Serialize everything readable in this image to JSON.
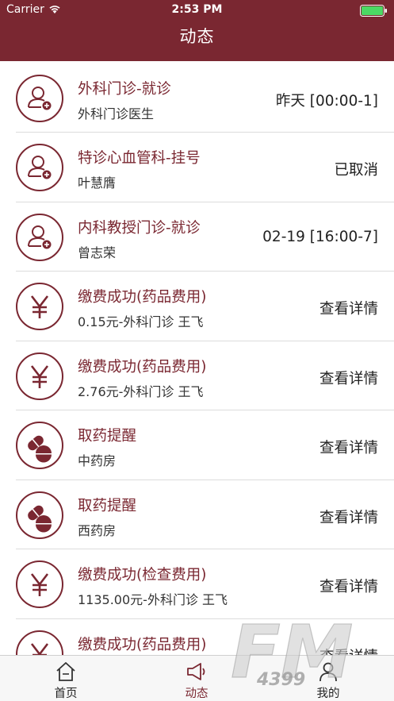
{
  "status_bar": {
    "carrier": "Carrier",
    "time": "2:53 PM"
  },
  "header": {
    "title": "动态"
  },
  "colors": {
    "brand": "#7a2731",
    "battery": "#4cd964",
    "background": "#ffffff"
  },
  "feed": [
    {
      "icon": "add-user-icon",
      "title": "外科门诊-就诊",
      "subtitle": "外科门诊医生",
      "right": "昨天 [00:00-1]"
    },
    {
      "icon": "add-user-icon",
      "title": "特诊心血管科-挂号",
      "subtitle": "叶慧膺",
      "right": "已取消"
    },
    {
      "icon": "add-user-icon",
      "title": "内科教授门诊-就诊",
      "subtitle": "曾志荣",
      "right": "02-19 [16:00-7]"
    },
    {
      "icon": "yen-icon",
      "title": "缴费成功(药品费用)",
      "subtitle": "0.15元-外科门诊 王飞",
      "right": "查看详情"
    },
    {
      "icon": "yen-icon",
      "title": "缴费成功(药品费用)",
      "subtitle": "2.76元-外科门诊 王飞",
      "right": "查看详情"
    },
    {
      "icon": "pill-icon",
      "title": "取药提醒",
      "subtitle": "中药房",
      "right": "查看详情"
    },
    {
      "icon": "pill-icon",
      "title": "取药提醒",
      "subtitle": "西药房",
      "right": "查看详情"
    },
    {
      "icon": "yen-icon",
      "title": "缴费成功(检查费用)",
      "subtitle": "1135.00元-外科门诊 王飞",
      "right": "查看详情"
    },
    {
      "icon": "yen-icon",
      "title": "缴费成功(药品费用)",
      "subtitle": "",
      "right": "查看详情"
    }
  ],
  "tabbar": [
    {
      "icon": "home-icon",
      "label": "首页",
      "active": false
    },
    {
      "icon": "megaphone-icon",
      "label": "动态",
      "active": true
    },
    {
      "icon": "person-icon",
      "label": "我的",
      "active": false
    }
  ],
  "watermark": {
    "big": "FM",
    "small": "4399"
  }
}
